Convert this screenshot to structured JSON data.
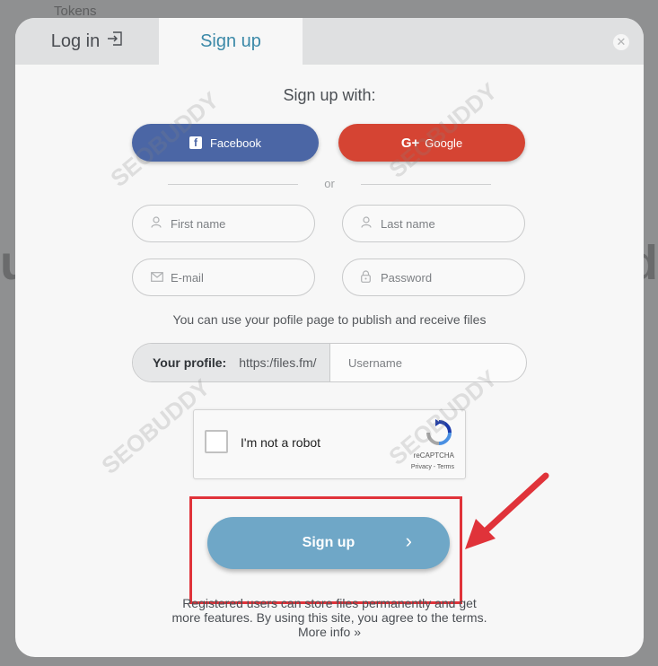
{
  "background": {
    "tokens_text": "Tokens",
    "left_fragment": "u",
    "right_fragment": "d"
  },
  "tabs": {
    "login": {
      "label": "Log in",
      "icon": "login-icon"
    },
    "signup": {
      "label": "Sign up"
    }
  },
  "heading": "Sign up with:",
  "social": {
    "facebook": {
      "label": "Facebook",
      "color": "#4b66a5"
    },
    "google": {
      "label": "Google",
      "color": "#d54433"
    }
  },
  "divider_text": "or",
  "form": {
    "first_name": {
      "placeholder": "First name",
      "icon": "user-icon"
    },
    "last_name": {
      "placeholder": "Last name",
      "icon": "user-icon"
    },
    "email": {
      "placeholder": "E-mail",
      "icon": "mail-icon"
    },
    "password": {
      "placeholder": "Password",
      "icon": "lock-icon"
    }
  },
  "profile_info": "You can use your pofile page to publish and receive files",
  "profile": {
    "label": "Your profile:",
    "url_prefix": "https:/files.fm/",
    "username_placeholder": "Username"
  },
  "captcha": {
    "label": "I'm not a robot",
    "brand": "reCAPTCHA",
    "links": "Privacy - Terms"
  },
  "signup_button": {
    "label": "Sign up",
    "color": "#6fa7c7"
  },
  "footer": {
    "line1": "Registered users can store files permanently and get",
    "line2": "more features. By using this site, you agree to the terms.",
    "more": "More info »"
  },
  "annotation": {
    "color": "#e0333a"
  },
  "watermark": "SEOBUDDY"
}
